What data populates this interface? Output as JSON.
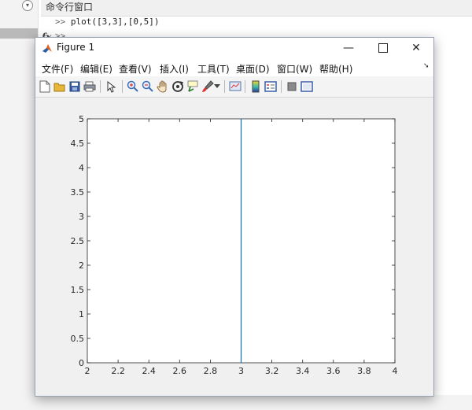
{
  "command_window": {
    "title": "命令行窗口",
    "prompt": ">>",
    "command": "plot([3,3],[0,5])",
    "fx_label": "fx",
    "second_prompt": ">>"
  },
  "figure": {
    "title": "Figure 1",
    "menu": [
      {
        "label": "文件(F)"
      },
      {
        "label": "编辑(E)"
      },
      {
        "label": "查看(V)"
      },
      {
        "label": "插入(I)"
      },
      {
        "label": "工具(T)"
      },
      {
        "label": "桌面(D)"
      },
      {
        "label": "窗口(W)"
      },
      {
        "label": "帮助(H)"
      }
    ],
    "toolbar_icons": [
      "new-figure-icon",
      "open-file-icon",
      "save-icon",
      "print-icon",
      "pointer-icon",
      "zoom-in-icon",
      "zoom-out-icon",
      "pan-hand-icon",
      "rotate-3d-icon",
      "data-cursor-icon",
      "brush-icon",
      "brush-dropdown-icon",
      "link-plot-icon",
      "colorbar-icon",
      "legend-icon",
      "hide-plot-tools-icon",
      "show-plot-tools-icon"
    ]
  },
  "chart_data": {
    "type": "line",
    "series": [
      {
        "x": [
          3,
          3
        ],
        "y": [
          0,
          5
        ],
        "color": "#0072bd"
      }
    ],
    "xlim": [
      2,
      4
    ],
    "ylim": [
      0,
      5
    ],
    "xticks": [
      "2",
      "2.2",
      "2.4",
      "2.6",
      "2.8",
      "3",
      "3.2",
      "3.4",
      "3.6",
      "3.8",
      "4"
    ],
    "yticks": [
      "0",
      "0.5",
      "1",
      "1.5",
      "2",
      "2.5",
      "3",
      "3.5",
      "4",
      "4.5",
      "5"
    ],
    "grid": false,
    "title": "",
    "xlabel": "",
    "ylabel": ""
  }
}
